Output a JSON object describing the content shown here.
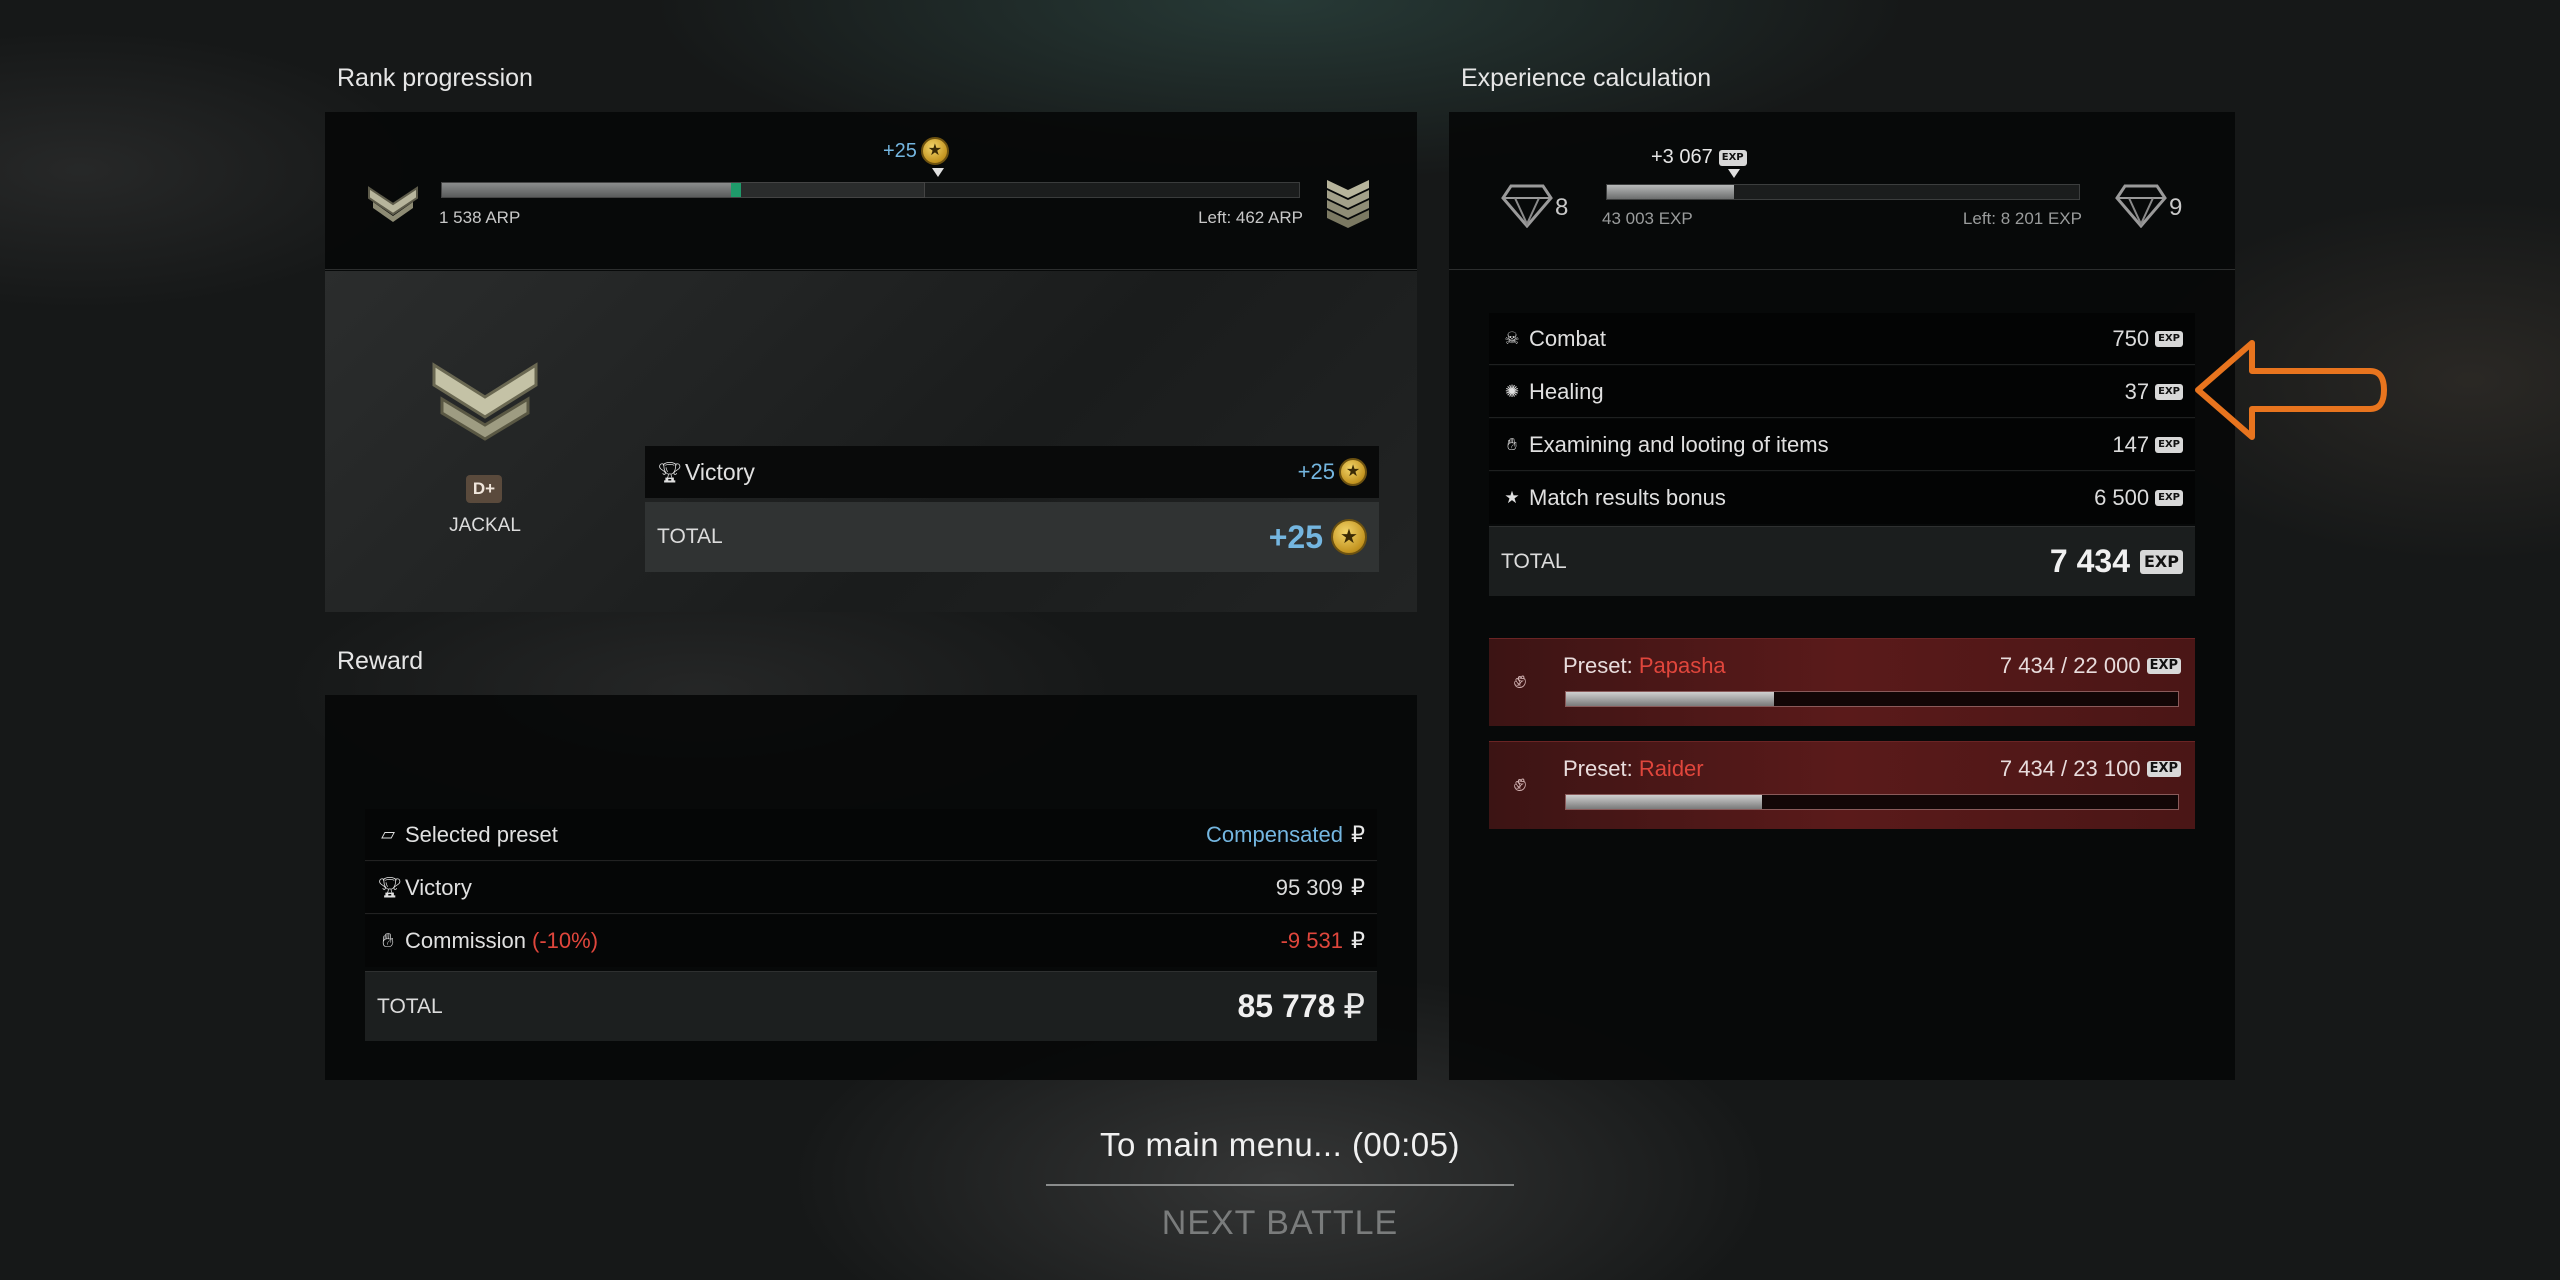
{
  "rank": {
    "title": "Rank progression",
    "gain": "+25",
    "current_points": "1 538 ARP",
    "left": "Left: 462 ARP",
    "progress_fraction": 0.6,
    "gain_fraction": 0.02,
    "badge_letter": "D+",
    "rank_name": "JACKAL",
    "rows": [
      {
        "label": "Victory",
        "value": "+25"
      }
    ],
    "total_label": "TOTAL",
    "total_value": "+25"
  },
  "experience": {
    "title": "Experience calculation",
    "gain": "+3 067",
    "current_level": "8",
    "next_level": "9",
    "current_exp": "43 003 EXP",
    "left": "Left: 8 201 EXP",
    "progress_fraction": 0.27,
    "exp_tag": "EXP",
    "rows": [
      {
        "icon": "combat-icon",
        "label": "Combat",
        "value": "750"
      },
      {
        "icon": "healing-icon",
        "label": "Healing",
        "value": "37"
      },
      {
        "icon": "looting-icon",
        "label": "Examining and looting of items",
        "value": "147"
      },
      {
        "icon": "star-icon",
        "label": "Match results bonus",
        "value": "6 500"
      }
    ],
    "total_label": "TOTAL",
    "total_value": "7 434",
    "presets": [
      {
        "prefix": "Preset: ",
        "name": "Papasha",
        "value": "7 434 / 22 000",
        "progress_fraction": 0.34
      },
      {
        "prefix": "Preset: ",
        "name": "Raider",
        "value": "7 434 / 23 100",
        "progress_fraction": 0.32
      }
    ]
  },
  "reward": {
    "title": "Reward",
    "rows": [
      {
        "label": "Selected preset",
        "value": "Compensated",
        "suffix": ""
      },
      {
        "label": "Victory",
        "value": "95 309",
        "suffix": ""
      },
      {
        "label": "Commission",
        "suffix": "(-10%)",
        "value": "-9 531"
      }
    ],
    "total_label": "TOTAL",
    "total_value": "85 778",
    "currency": "₽"
  },
  "footer": {
    "main_menu": "To main menu... (00:05)",
    "next_battle": "NEXT BATTLE"
  },
  "colors": {
    "accent_blue": "#74b6e0",
    "accent_red": "#e0463c",
    "progress_green": "#1f9a6a",
    "arrow_orange": "#e8741e"
  }
}
